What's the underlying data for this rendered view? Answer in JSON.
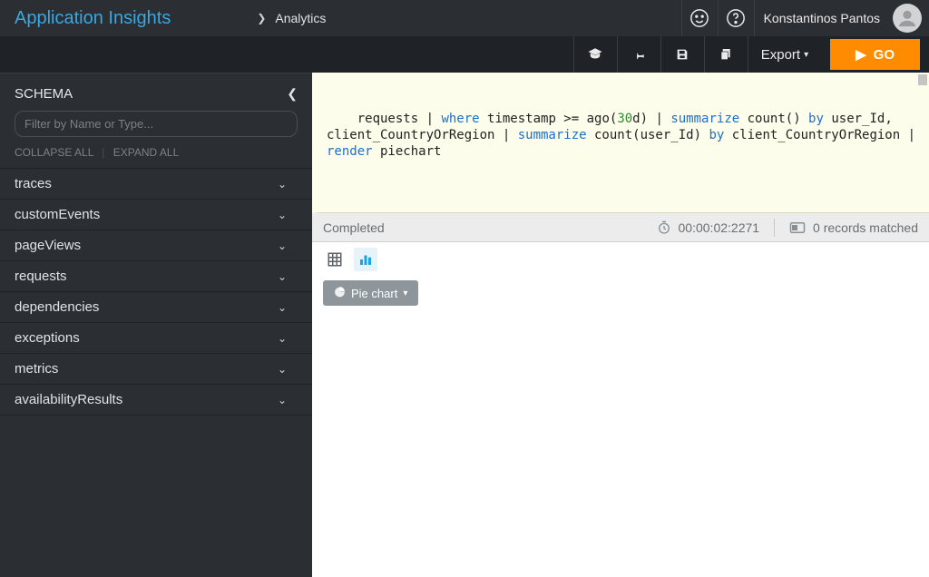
{
  "header": {
    "brand": "Application Insights",
    "breadcrumb": "Analytics",
    "username": "Konstantinos Pantos"
  },
  "toolbar": {
    "export_label": "Export",
    "go_label": "GO"
  },
  "sidebar": {
    "title": "SCHEMA",
    "filter_placeholder": "Filter by Name or Type...",
    "collapse_label": "COLLAPSE ALL",
    "expand_label": "EXPAND ALL",
    "items": [
      {
        "label": "traces"
      },
      {
        "label": "customEvents"
      },
      {
        "label": "pageViews"
      },
      {
        "label": "requests"
      },
      {
        "label": "dependencies"
      },
      {
        "label": "exceptions"
      },
      {
        "label": "metrics"
      },
      {
        "label": "availabilityResults"
      }
    ]
  },
  "editor": {
    "tokens": [
      {
        "t": "plain",
        "v": "requests | "
      },
      {
        "t": "kw",
        "v": "where"
      },
      {
        "t": "plain",
        "v": " timestamp >= ago("
      },
      {
        "t": "num",
        "v": "30"
      },
      {
        "t": "plain",
        "v": "d) | "
      },
      {
        "t": "kw",
        "v": "summarize"
      },
      {
        "t": "plain",
        "v": " count() "
      },
      {
        "t": "kw",
        "v": "by"
      },
      {
        "t": "plain",
        "v": " user_Id, client_CountryOrRegion | "
      },
      {
        "t": "kw",
        "v": "summarize"
      },
      {
        "t": "plain",
        "v": " count(user_Id) "
      },
      {
        "t": "kw",
        "v": "by"
      },
      {
        "t": "plain",
        "v": " client_CountryOrRegion | "
      },
      {
        "t": "kw",
        "v": "render"
      },
      {
        "t": "plain",
        "v": " piechart"
      }
    ]
  },
  "status": {
    "state": "Completed",
    "duration": "00:00:02:2271",
    "records": "0 records matched"
  },
  "chart": {
    "selector_label": "Pie chart"
  }
}
